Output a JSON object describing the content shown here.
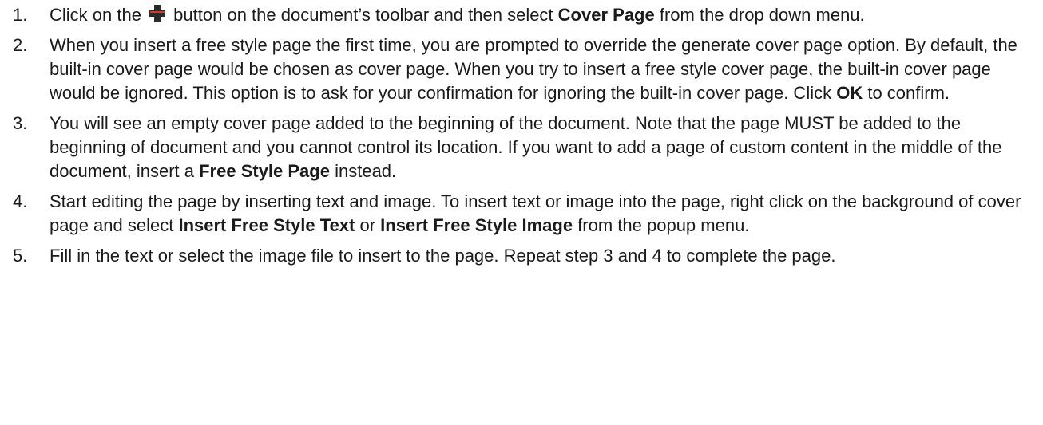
{
  "steps": [
    {
      "num": "1.",
      "parts": [
        {
          "t": "Click on the "
        },
        {
          "icon": "plus-icon"
        },
        {
          "t": " button on the document’s toolbar and then select "
        },
        {
          "b": "Cover Page"
        },
        {
          "t": " from the drop down menu."
        }
      ]
    },
    {
      "num": "2.",
      "parts": [
        {
          "t": "When you insert a free style page the first time, you are prompted to override the generate cover page option. By default, the built-in cover page would be chosen as cover page. When you try to insert a free style cover page, the built-in cover page would be ignored. This option is to ask for your confirmation for ignoring the built-in cover page. Click "
        },
        {
          "b": "OK"
        },
        {
          "t": " to confirm."
        }
      ]
    },
    {
      "num": "3.",
      "parts": [
        {
          "t": "You will see an empty cover page added to the beginning of the document. Note that the page MUST be added to the beginning of document and you cannot control its location. If you want to add a page of custom content in the middle of the document, insert a "
        },
        {
          "b": "Free Style Page"
        },
        {
          "t": " instead."
        }
      ]
    },
    {
      "num": "4.",
      "parts": [
        {
          "t": "Start editing the page by inserting text and image. To insert text or image into the page, right click on the background of cover page and select "
        },
        {
          "b": "Insert Free Style Text"
        },
        {
          "t": " or "
        },
        {
          "b": "Insert Free Style Image"
        },
        {
          "t": " from the popup menu."
        }
      ]
    },
    {
      "num": "5.",
      "parts": [
        {
          "t": "Fill in the text or select the image file to insert to the page. Repeat step 3 and 4 to complete the page."
        }
      ]
    }
  ]
}
